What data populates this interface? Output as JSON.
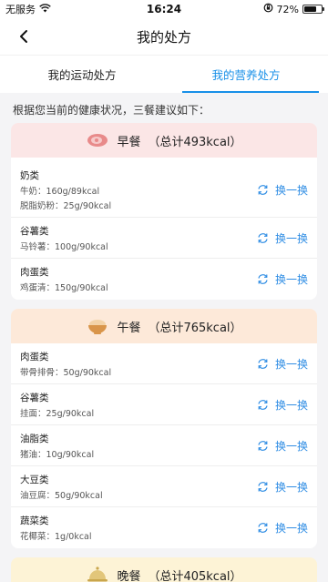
{
  "status": {
    "carrier": "无服务",
    "time": "16:24",
    "battery": "72%",
    "battery_level": 0.72
  },
  "nav": {
    "title": "我的处方"
  },
  "tabs": [
    {
      "label": "我的运动处方",
      "active": false
    },
    {
      "label": "我的营养处方",
      "active": true
    }
  ],
  "intro": "根据您当前的健康状况，三餐建议如下：",
  "swap_label": "换一换",
  "meals": {
    "breakfast": {
      "name": "早餐",
      "total": "（总计493kcal）",
      "items": [
        {
          "category": "奶类",
          "details": [
            "牛奶：160g/89kcal",
            "脱脂奶粉：25g/90kcal"
          ]
        },
        {
          "category": "谷薯类",
          "details": [
            "马铃薯：100g/90kcal"
          ]
        },
        {
          "category": "肉蛋类",
          "details": [
            "鸡蛋清：150g/90kcal"
          ]
        }
      ]
    },
    "lunch": {
      "name": "午餐",
      "total": "（总计765kcal）",
      "items": [
        {
          "category": "肉蛋类",
          "details": [
            "带骨排骨：50g/90kcal"
          ]
        },
        {
          "category": "谷薯类",
          "details": [
            "挂面：25g/90kcal"
          ]
        },
        {
          "category": "油脂类",
          "details": [
            "猪油：10g/90kcal"
          ]
        },
        {
          "category": "大豆类",
          "details": [
            "油豆腐：50g/90kcal"
          ]
        },
        {
          "category": "蔬菜类",
          "details": [
            "花椰菜：1g/0kcal"
          ]
        }
      ]
    },
    "dinner": {
      "name": "晚餐",
      "total": "（总计405kcal）"
    }
  },
  "colors": {
    "accent": "#1890e8",
    "breakfast_header": "#fbe6e6",
    "lunch_header": "#fde9d9",
    "dinner_header": "#fdf3d6"
  }
}
